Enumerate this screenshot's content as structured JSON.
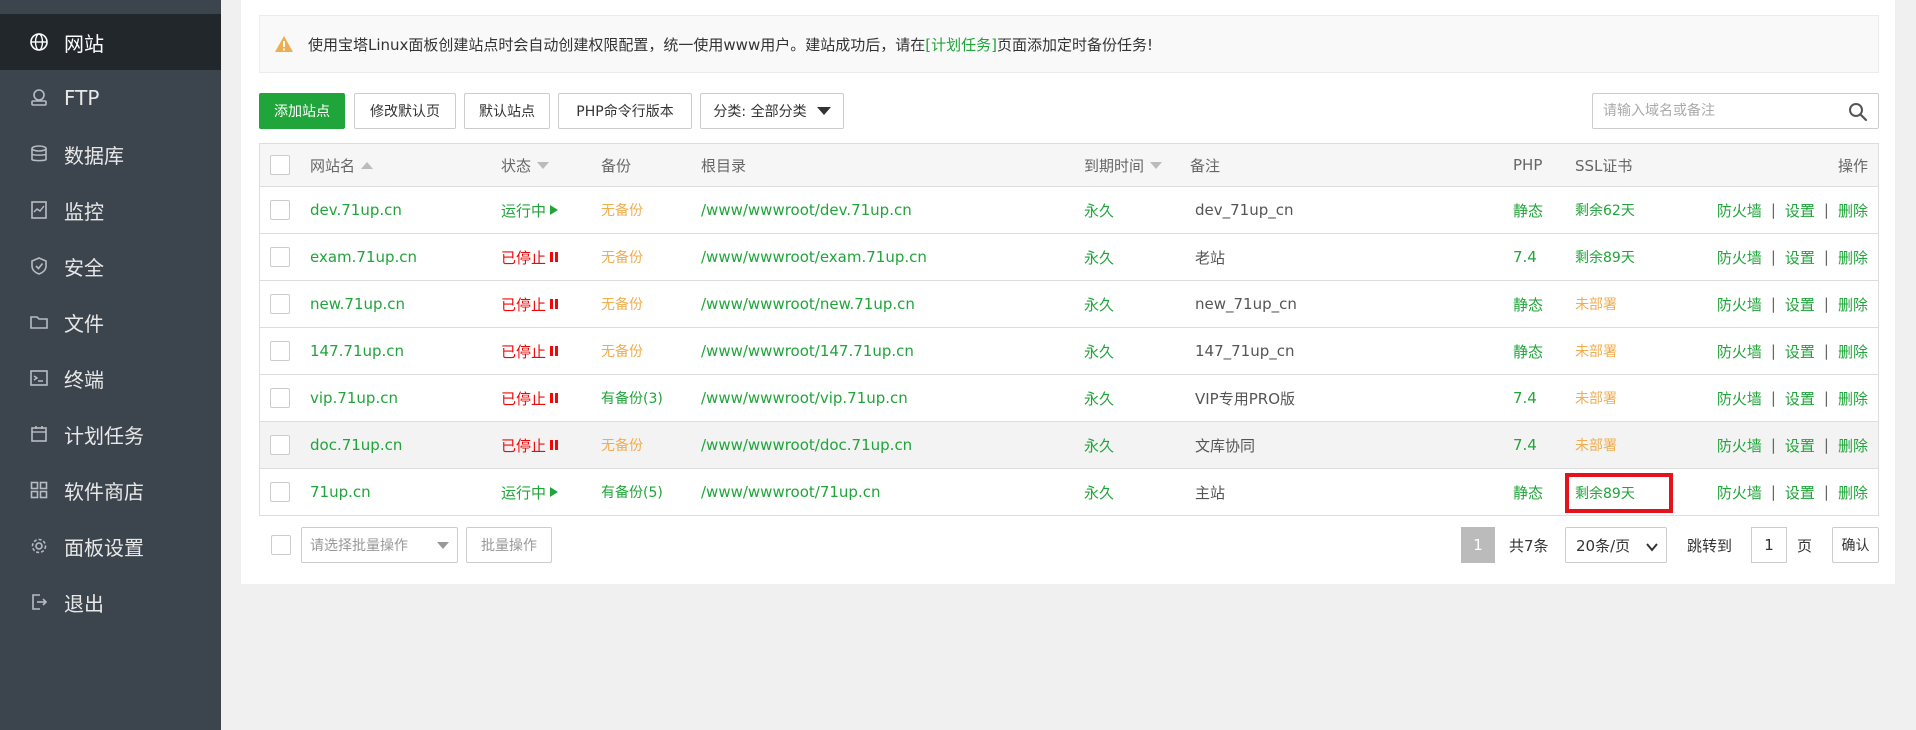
{
  "sidebar": {
    "items": [
      {
        "label": "网站",
        "icon": "globe-icon",
        "active": true
      },
      {
        "label": "FTP",
        "icon": "ftp-icon",
        "active": false
      },
      {
        "label": "数据库",
        "icon": "database-icon",
        "active": false
      },
      {
        "label": "监控",
        "icon": "monitor-icon",
        "active": false
      },
      {
        "label": "安全",
        "icon": "shield-icon",
        "active": false
      },
      {
        "label": "文件",
        "icon": "folder-icon",
        "active": false
      },
      {
        "label": "终端",
        "icon": "terminal-icon",
        "active": false
      },
      {
        "label": "计划任务",
        "icon": "calendar-icon",
        "active": false
      },
      {
        "label": "软件商店",
        "icon": "grid-icon",
        "active": false
      },
      {
        "label": "面板设置",
        "icon": "gear-icon",
        "active": false
      },
      {
        "label": "退出",
        "icon": "logout-icon",
        "active": false
      }
    ]
  },
  "notice": {
    "text_before": "使用宝塔Linux面板创建站点时会自动创建权限配置，统一使用www用户。建站成功后，请在",
    "link": "[计划任务]",
    "text_after": "页面添加定时备份任务!"
  },
  "toolbar": {
    "add_site": "添加站点",
    "edit_default_page": "修改默认页",
    "default_site": "默认站点",
    "php_cli_version": "PHP命令行版本",
    "category": "分类: 全部分类",
    "search_placeholder": "请输入域名或备注"
  },
  "columns": {
    "name": "网站名",
    "status": "状态",
    "backup": "备份",
    "root": "根目录",
    "expire": "到期时间",
    "remark": "备注",
    "php": "PHP",
    "ssl": "SSL证书",
    "ops": "操作"
  },
  "ops_labels": {
    "firewall": "防火墙",
    "settings": "设置",
    "delete": "删除",
    "sep": "|"
  },
  "rows": [
    {
      "name": "dev.71up.cn",
      "status": "运行中",
      "running": true,
      "backup": "无备份",
      "has_backup": false,
      "root": "/www/wwwroot/dev.71up.cn",
      "expire": "永久",
      "remark": "dev_71up_cn",
      "php": "静态",
      "ssl": "剩余62天",
      "ssl_ok": true
    },
    {
      "name": "exam.71up.cn",
      "status": "已停止",
      "running": false,
      "backup": "无备份",
      "has_backup": false,
      "root": "/www/wwwroot/exam.71up.cn",
      "expire": "永久",
      "remark": "老站",
      "php": "7.4",
      "ssl": "剩余89天",
      "ssl_ok": true
    },
    {
      "name": "new.71up.cn",
      "status": "已停止",
      "running": false,
      "backup": "无备份",
      "has_backup": false,
      "root": "/www/wwwroot/new.71up.cn",
      "expire": "永久",
      "remark": "new_71up_cn",
      "php": "静态",
      "ssl": "未部署",
      "ssl_ok": false
    },
    {
      "name": "147.71up.cn",
      "status": "已停止",
      "running": false,
      "backup": "无备份",
      "has_backup": false,
      "root": "/www/wwwroot/147.71up.cn",
      "expire": "永久",
      "remark": "147_71up_cn",
      "php": "静态",
      "ssl": "未部署",
      "ssl_ok": false
    },
    {
      "name": "vip.71up.cn",
      "status": "已停止",
      "running": false,
      "backup": "有备份(3)",
      "has_backup": true,
      "root": "/www/wwwroot/vip.71up.cn",
      "expire": "永久",
      "remark": "VIP专用PRO版",
      "php": "7.4",
      "ssl": "未部署",
      "ssl_ok": false
    },
    {
      "name": "doc.71up.cn",
      "status": "已停止",
      "running": false,
      "backup": "无备份",
      "has_backup": false,
      "root": "/www/wwwroot/doc.71up.cn",
      "expire": "永久",
      "remark": "文库协同",
      "php": "7.4",
      "ssl": "未部署",
      "ssl_ok": false
    },
    {
      "name": "71up.cn",
      "status": "运行中",
      "running": true,
      "backup": "有备份(5)",
      "has_backup": true,
      "root": "/www/wwwroot/71up.cn",
      "expire": "永久",
      "remark": "主站",
      "php": "静态",
      "ssl": "剩余89天",
      "ssl_ok": true
    }
  ],
  "footer": {
    "batch_select_placeholder": "请选择批量操作",
    "batch_button": "批量操作",
    "current_page": "1",
    "total": "共7条",
    "per_page": "20条/页",
    "jump_label": "跳转到",
    "jump_value": "1",
    "page_unit": "页",
    "confirm": "确认"
  },
  "colors": {
    "accent": "#20a53a",
    "stopped": "#ef0808",
    "warning": "#f0ad4e",
    "sidebar": "#3c444d",
    "highlight_box": "#e3121b"
  }
}
